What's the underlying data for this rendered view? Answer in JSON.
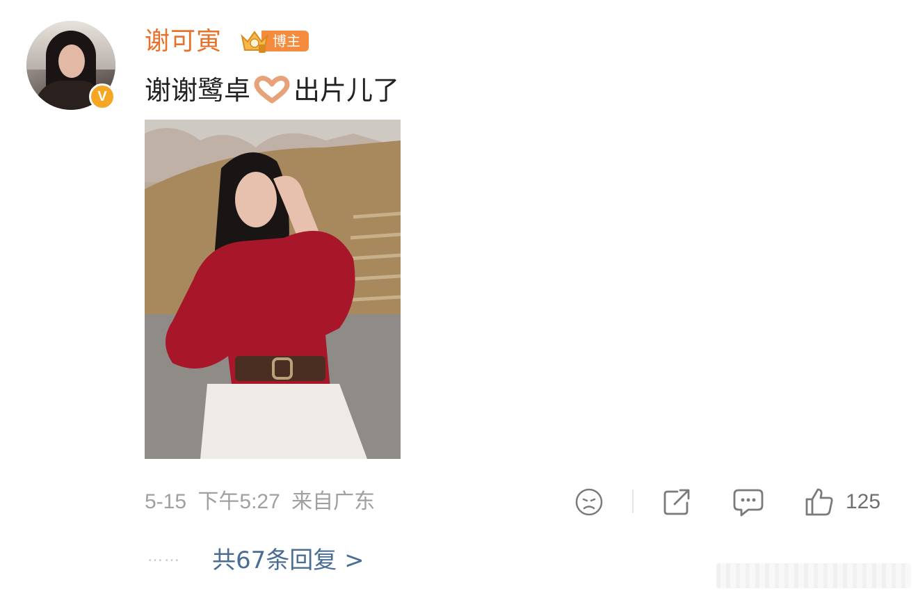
{
  "post": {
    "username": "谢可寅",
    "badge_label": "博主",
    "verified_mark": "V",
    "text_before": "谢谢鹭卓",
    "text_after": "出片儿了",
    "emoji": "heart-hands-icon"
  },
  "meta": {
    "date": "5-15",
    "time": "下午5:27",
    "location": "来自广东"
  },
  "actions": {
    "like_count": "125"
  },
  "replies": {
    "dots": "……",
    "label": "共67条回复 >"
  },
  "colors": {
    "username": "#e8722b",
    "badge": "#f58b3c",
    "link": "#4a6d94",
    "meta": "#a0a0a0"
  }
}
